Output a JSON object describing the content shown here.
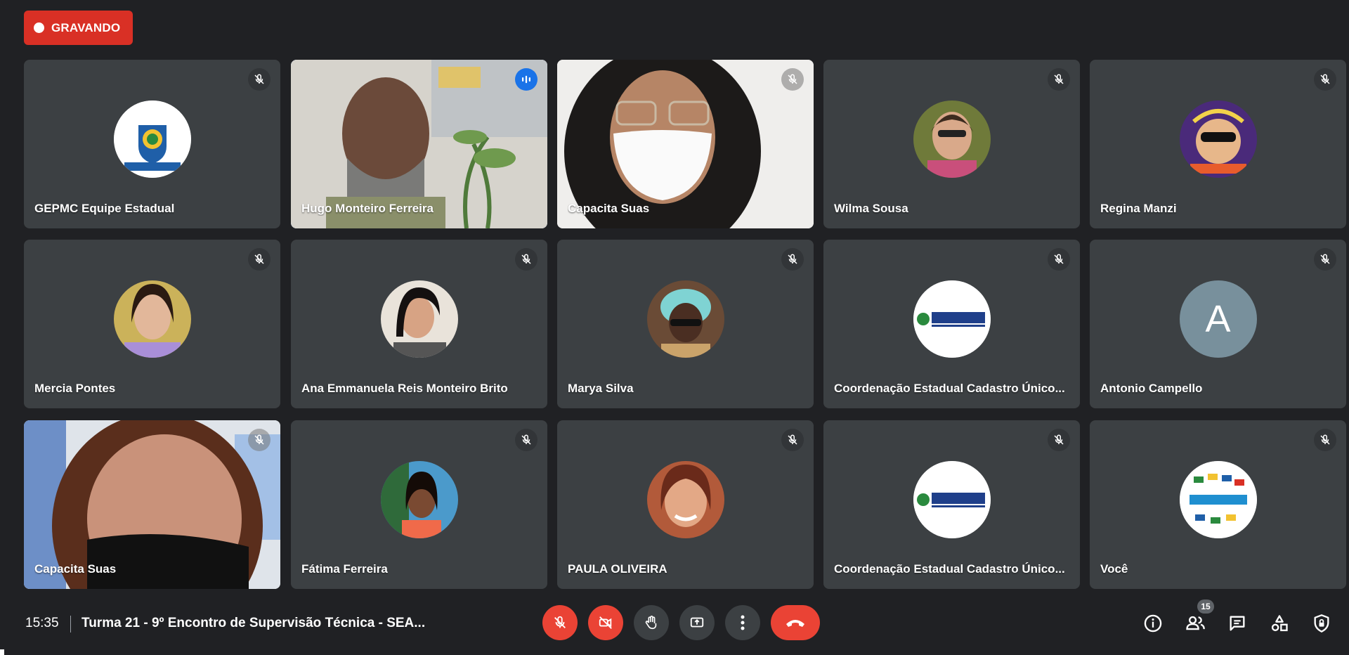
{
  "recording": {
    "label": "GRAVANDO"
  },
  "tiles": [
    {
      "name": "GEPMC Equipe Estadual"
    },
    {
      "name": "Hugo Monteiro Ferreira"
    },
    {
      "name": "Capacita Suas"
    },
    {
      "name": "Wilma Sousa"
    },
    {
      "name": "Regina Manzi"
    },
    {
      "name": "Mercia Pontes"
    },
    {
      "name": "Ana Emmanuela Reis Monteiro Brito"
    },
    {
      "name": "Marya Silva"
    },
    {
      "name": "Coordenação Estadual Cadastro Único..."
    },
    {
      "name": "Antonio Campello",
      "avatar_letter": "A"
    },
    {
      "name": "Capacita Suas"
    },
    {
      "name": "Fátima Ferreira"
    },
    {
      "name": "PAULA OLIVEIRA"
    },
    {
      "name": "Coordenação Estadual Cadastro Único..."
    },
    {
      "name": "Você"
    }
  ],
  "bottom": {
    "time": "15:35",
    "meeting_title": "Turma 21 - 9º Encontro de Supervisão Técnica - SEA...",
    "participants_count": "15"
  },
  "colors": {
    "accent": "#8ab4f8",
    "danger": "#ea4335",
    "tile_bg": "#3c4043",
    "page_bg": "#202124"
  },
  "icons": {
    "mic_off": "mic-off-icon",
    "speaking": "audio-bars-icon",
    "cam_off": "camera-off-icon",
    "hand": "raise-hand-icon",
    "present": "present-screen-icon",
    "more": "more-vert-icon",
    "end_call": "end-call-icon",
    "info": "info-icon",
    "people": "people-icon",
    "chat": "chat-icon",
    "activities": "activities-icon",
    "host": "host-controls-icon"
  }
}
